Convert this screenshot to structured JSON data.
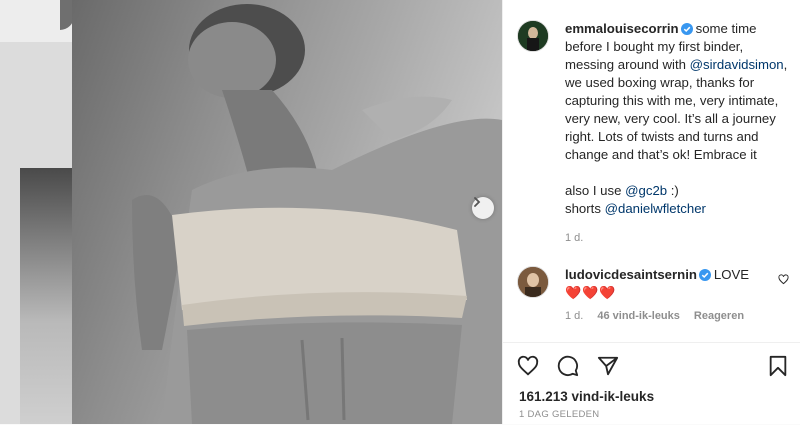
{
  "post": {
    "author": "emmalouisecorrin",
    "caption_parts": {
      "p1": "some time before I bought my first binder, messing around with",
      "mention1": "@sirdavidsimon",
      "p2": ", we used boxing wrap, thanks for capturing this with me, very intimate, very new, very cool. It’s all a journey right. Lots of twists and turns and change and that’s ok! Embrace it",
      "p3": "also I use",
      "mention2": "@gc2b",
      "p3_end": " :)",
      "p4": "shorts",
      "mention3": "@danielwfletcher"
    },
    "caption_time": "1 d.",
    "likes": "161.213 vind-ik-leuks",
    "date": "1 DAG GELEDEN"
  },
  "comment": {
    "author": "ludovicdesaintsernin",
    "text": "LOVE",
    "hearts": "❤️❤️❤️",
    "time": "1 d.",
    "likes": "46 vind-ik-leuks",
    "reply": "Reageren"
  },
  "icons": {
    "verified": "verified-badge-icon",
    "next": "chevron-right-icon",
    "like": "heart-icon",
    "comment": "comment-bubble-icon",
    "share": "paper-plane-icon",
    "save": "bookmark-icon"
  },
  "colors": {
    "verified": "#3897f0",
    "mention": "#00376b",
    "meta": "#8e8e8e",
    "heart": "#e0245e"
  }
}
